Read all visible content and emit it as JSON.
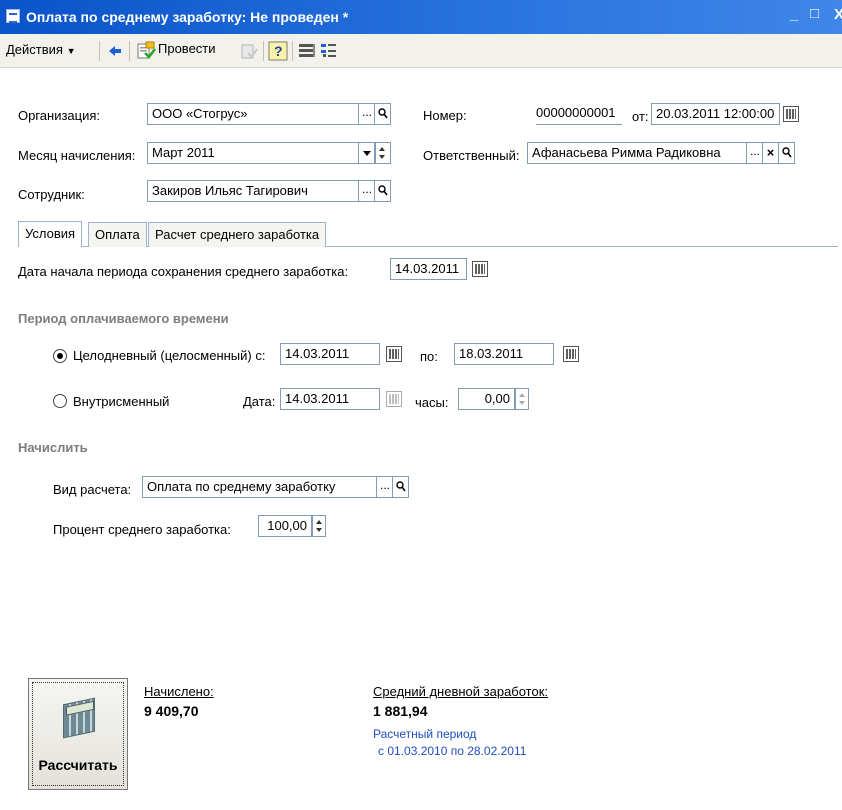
{
  "window": {
    "title": "Оплата по среднему заработку: Не проведен *",
    "controls": {
      "minimize": "_",
      "maximize": "□",
      "close": "X"
    }
  },
  "toolbar": {
    "actions_label": "Действия",
    "post_label": "Провести"
  },
  "header": {
    "organization": {
      "label": "Организация:",
      "value": "ООО «Стогрус»"
    },
    "number": {
      "label": "Номер:",
      "value": "00000000001"
    },
    "date": {
      "label": "от:",
      "value": "20.03.2011 12:00:00"
    },
    "accrual_month": {
      "label": "Месяц начисления:",
      "value": "Март 2011"
    },
    "responsible": {
      "label": "Ответственный:",
      "value": "Афанасьева Римма Радиковна"
    },
    "employee": {
      "label": "Сотрудник:",
      "value": "Закиров Ильяс Тагирович"
    }
  },
  "tabs": [
    {
      "label": "Условия",
      "active": true
    },
    {
      "label": "Оплата",
      "active": false
    },
    {
      "label": "Расчет среднего заработка",
      "active": false
    }
  ],
  "conditions": {
    "start_date": {
      "label": "Дата начала периода сохранения среднего заработка:",
      "value": "14.03.2011"
    },
    "period_title": "Период оплачиваемого времени",
    "full_day": {
      "label": "Целодневный (целосменный) с:",
      "from": "14.03.2011",
      "to_label": "по:",
      "to": "18.03.2011",
      "selected": true
    },
    "intrashift": {
      "label": "Внутрисменный",
      "date_label": "Дата:",
      "date": "14.03.2011",
      "hours_label": "часы:",
      "hours": "0,00",
      "selected": false
    },
    "accrue_title": "Начислить",
    "calc_type": {
      "label": "Вид расчета:",
      "value": "Оплата по среднему заработку"
    },
    "percent": {
      "label": "Процент среднего заработка:",
      "value": "100,00"
    }
  },
  "summary": {
    "calculate_label": "Рассчитать",
    "accrued_label": "Начислено:",
    "accrued_value": "9 409,70",
    "avg_daily_label": "Средний дневной заработок:",
    "avg_daily_value": "1 881,94",
    "period_line1": "Расчетный период",
    "period_line2": "с 01.03.2010 по 28.02.2011"
  }
}
